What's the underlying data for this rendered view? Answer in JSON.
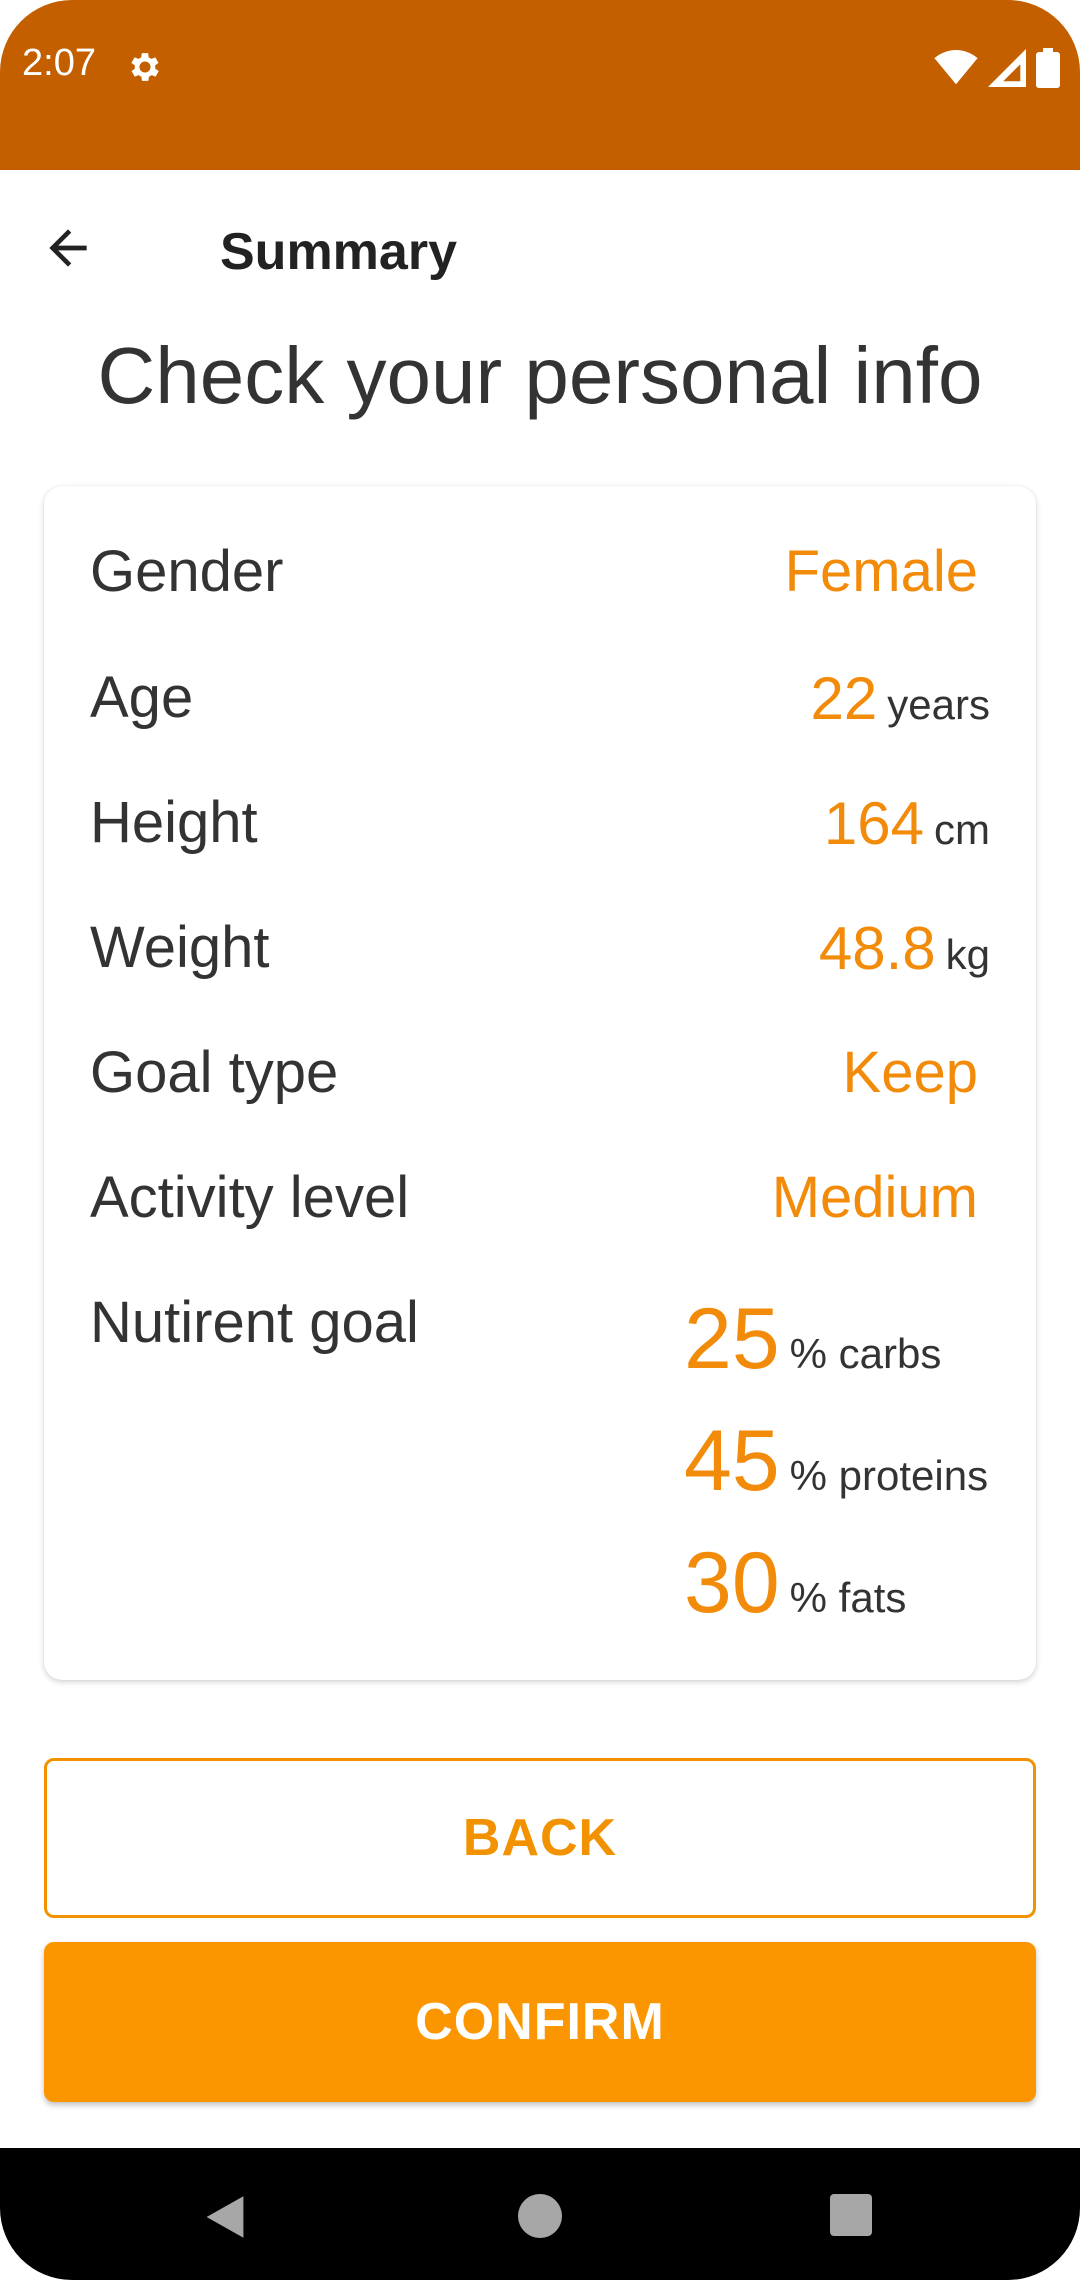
{
  "status_bar": {
    "time": "2:07",
    "color": "#c45f00"
  },
  "app_bar": {
    "title": "Summary"
  },
  "headline": "Check your personal info",
  "summary": {
    "gender": {
      "label": "Gender",
      "value": "Female"
    },
    "age": {
      "label": "Age",
      "value": "22",
      "unit": "years"
    },
    "height": {
      "label": "Height",
      "value": "164",
      "unit": "cm"
    },
    "weight": {
      "label": "Weight",
      "value": "48.8",
      "unit": "kg"
    },
    "goal_type": {
      "label": "Goal type",
      "value": "Keep"
    },
    "activity_level": {
      "label": "Activity level",
      "value": "Medium"
    },
    "nutrient_goal": {
      "label": "Nutirent goal",
      "items": [
        {
          "value": "25",
          "unit": "% carbs"
        },
        {
          "value": "45",
          "unit": "% proteins"
        },
        {
          "value": "30",
          "unit": "% fats"
        }
      ]
    }
  },
  "buttons": {
    "back_label": "BACK",
    "confirm_label": "CONFIRM"
  },
  "colors": {
    "accent": "#f28a0a",
    "confirm_bg": "#fc9600",
    "status_bar": "#c45f00",
    "text": "#333333"
  },
  "icons": {
    "status_settings": "gear-icon",
    "status_wifi": "wifi-icon",
    "status_signal": "signal-icon",
    "status_battery": "battery-icon",
    "back": "arrow-left-icon",
    "nav_back": "triangle-back-icon",
    "nav_home": "circle-home-icon",
    "nav_recents": "square-recents-icon"
  }
}
